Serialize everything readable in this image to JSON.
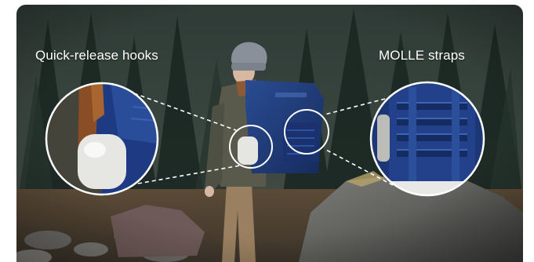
{
  "callouts": {
    "left": {
      "label": "Quick-release hooks",
      "icon": "zoom-circle-bottle-hook"
    },
    "right": {
      "label": "MOLLE straps",
      "icon": "zoom-circle-molle-webbing"
    }
  },
  "palette": {
    "forest_dark": "#1e2a24",
    "backpack_navy": "#1f3a78",
    "hat_grey": "#8a9099",
    "pants_tan": "#9a8060",
    "rock_grey": "#5a5a58",
    "callout_line": "#ffffff"
  }
}
